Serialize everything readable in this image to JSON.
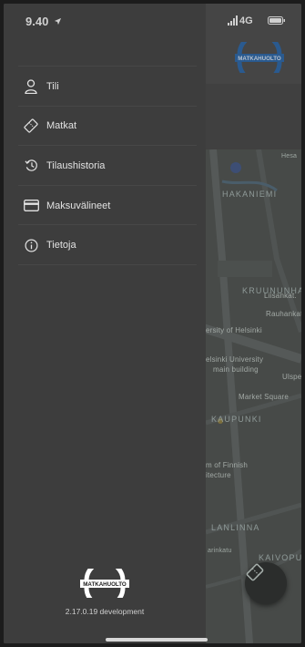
{
  "status_bar": {
    "time": "9.40",
    "network": "4G",
    "location_icon": "location-arrow-icon",
    "signal_icon": "signal-bars-icon",
    "battery_icon": "battery-icon"
  },
  "brand": {
    "name": "MATKAHUOLTO",
    "primary_color": "#17427a",
    "drawer_bg": "#3d3d3d"
  },
  "drawer": {
    "menu": [
      {
        "label": "Tili",
        "icon": "user-icon"
      },
      {
        "label": "Matkat",
        "icon": "ticket-icon"
      },
      {
        "label": "Tilaushistoria",
        "icon": "history-icon"
      },
      {
        "label": "Maksuvälineet",
        "icon": "credit-card-icon"
      },
      {
        "label": "Tietoja",
        "icon": "info-icon"
      }
    ],
    "version": "2.17.0.19  development"
  },
  "map": {
    "labels": [
      "HAKANIEMI",
      "Liisankat.",
      "KRUUNUNHA",
      "Rauhankat.",
      "ersity of Helsinki",
      "elsinki University",
      "main building",
      "Market Square",
      "Ulspe",
      "KAUPUNKI",
      "m of Finnish",
      "itecture",
      "LANLINNA",
      "KAIVOPU",
      "arinkatu",
      "Hesa"
    ]
  }
}
